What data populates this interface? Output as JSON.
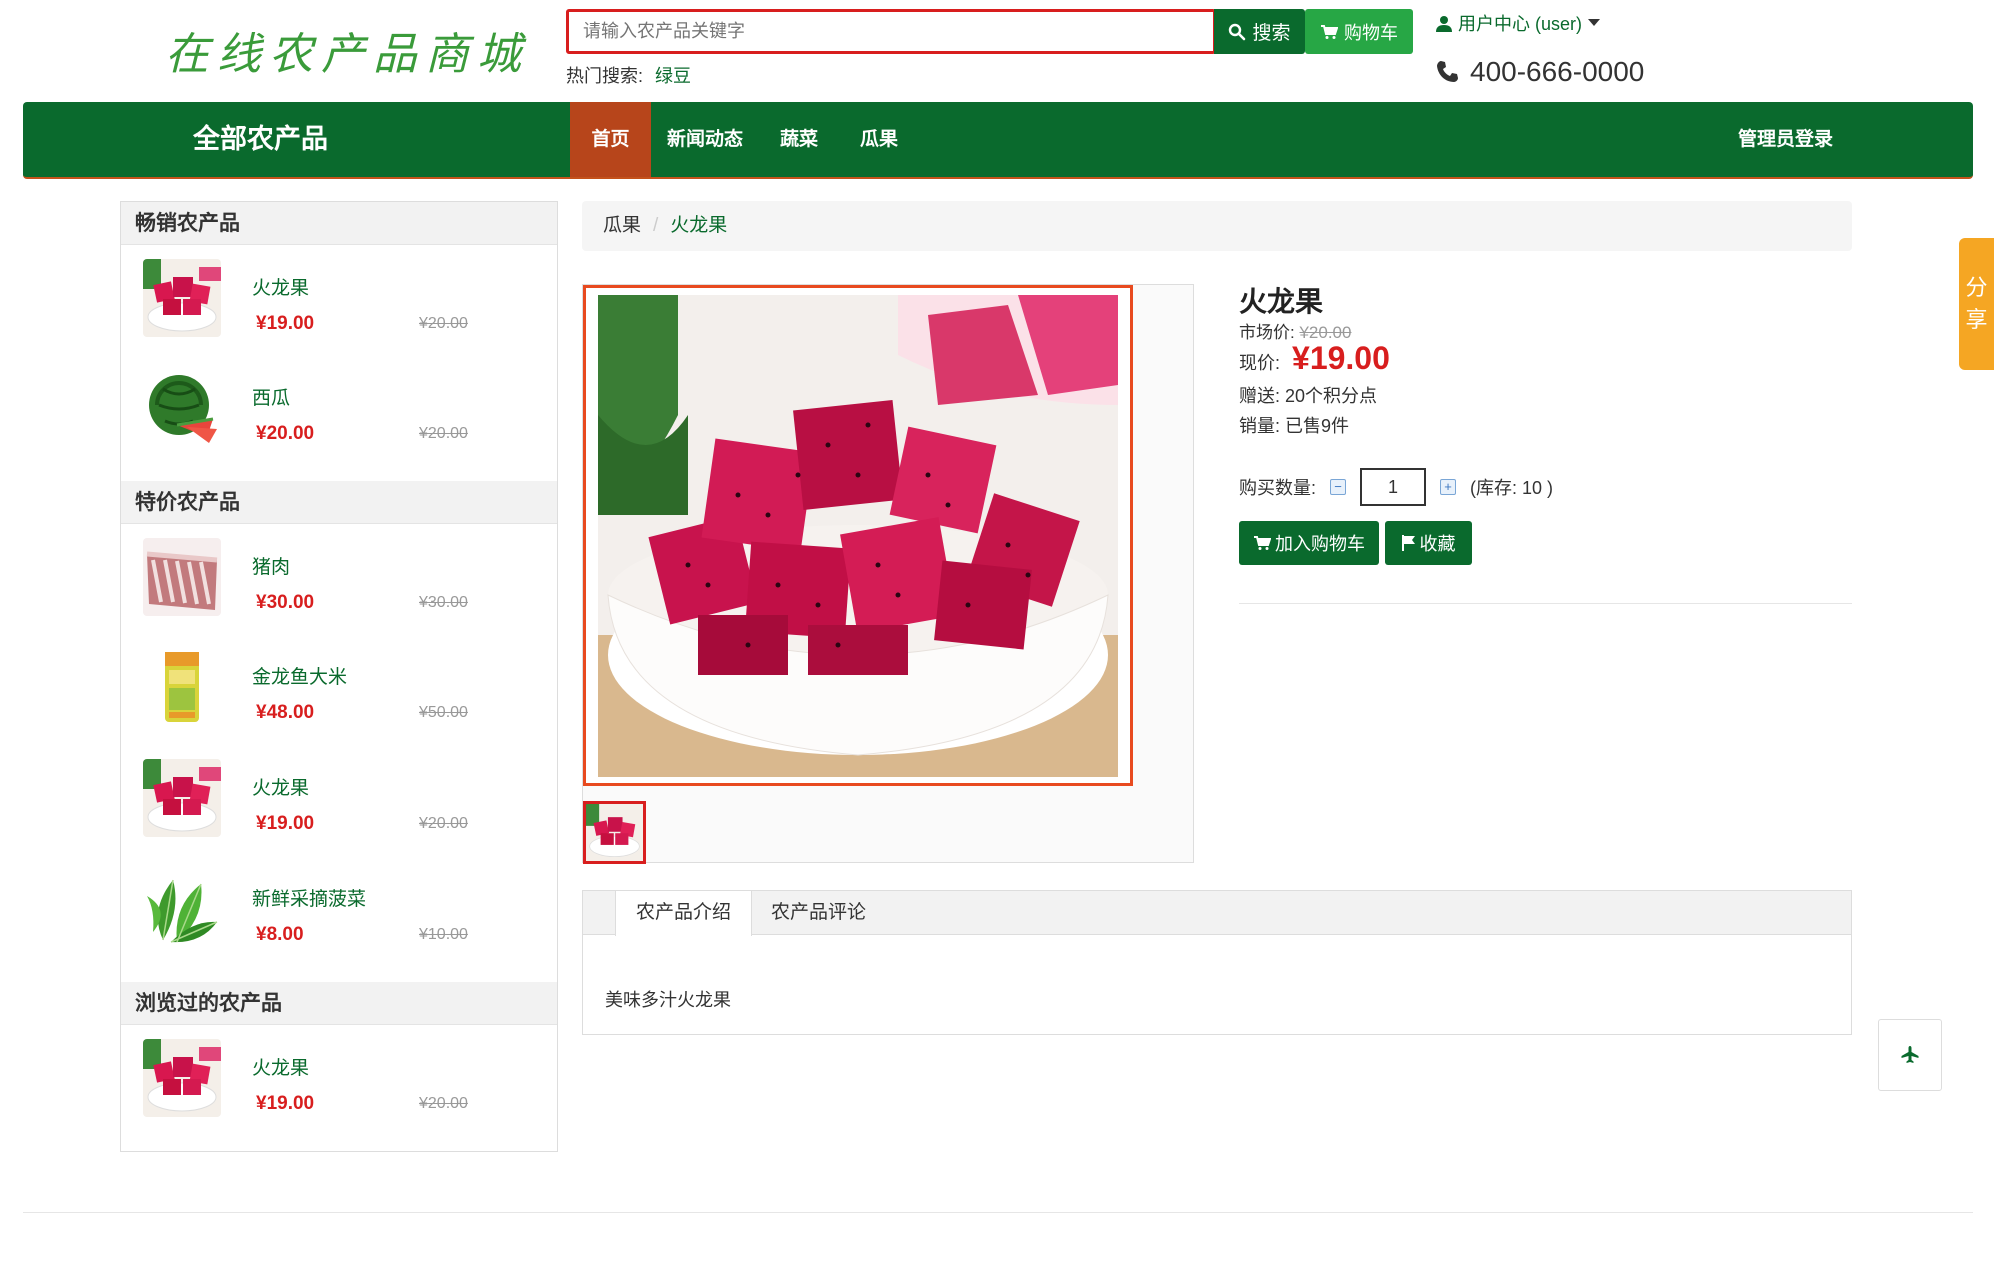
{
  "header": {
    "logo": "在线农产品商城",
    "search_placeholder": "请输入农产品关键字",
    "search_label": "搜索",
    "cart_label": "购物车",
    "hot_search_label": "热门搜索:",
    "hot_search_item": "绿豆",
    "user_center": "用户中心 (user)",
    "phone": "400-666-0000"
  },
  "nav": {
    "all_products": "全部农产品",
    "items": [
      "首页",
      "新闻动态",
      "蔬菜",
      "瓜果"
    ],
    "admin_login": "管理员登录"
  },
  "sidebar": {
    "bestsellers": {
      "title": "畅销农产品",
      "items": [
        {
          "name": "火龙果",
          "price": "¥19.00",
          "old": "¥20.00"
        },
        {
          "name": "西瓜",
          "price": "¥20.00",
          "old": "¥20.00"
        }
      ]
    },
    "specials": {
      "title": "特价农产品",
      "items": [
        {
          "name": "猪肉",
          "price": "¥30.00",
          "old": "¥30.00"
        },
        {
          "name": "金龙鱼大米",
          "price": "¥48.00",
          "old": "¥50.00"
        },
        {
          "name": "火龙果",
          "price": "¥19.00",
          "old": "¥20.00"
        },
        {
          "name": "新鲜采摘菠菜",
          "price": "¥8.00",
          "old": "¥10.00"
        }
      ]
    },
    "viewed": {
      "title": "浏览过的农产品",
      "items": [
        {
          "name": "火龙果",
          "price": "¥19.00",
          "old": "¥20.00"
        }
      ]
    }
  },
  "breadcrumb": [
    "瓜果",
    "火龙果"
  ],
  "product": {
    "title": "火龙果",
    "market_label": "市场价:",
    "market_price": "¥20.00",
    "now_label": "现价:",
    "now_price": "¥19.00",
    "gift": "赠送: 20个积分点",
    "sold": "销量: 已售9件",
    "qty_label": "购买数量:",
    "qty_value": "1",
    "stock": "(库存: 10 )",
    "add_cart": "加入购物车",
    "favorite": "收藏"
  },
  "tabs": {
    "items": [
      "农产品介绍",
      "农产品评论"
    ],
    "content": "美味多汁火龙果"
  },
  "float": {
    "share": [
      "分",
      "享"
    ]
  },
  "colors": {
    "brand_green": "#0a6a2d",
    "accent_orange": "#b7451b",
    "price_red": "#d81e1e",
    "share_orange": "#f5a623"
  }
}
